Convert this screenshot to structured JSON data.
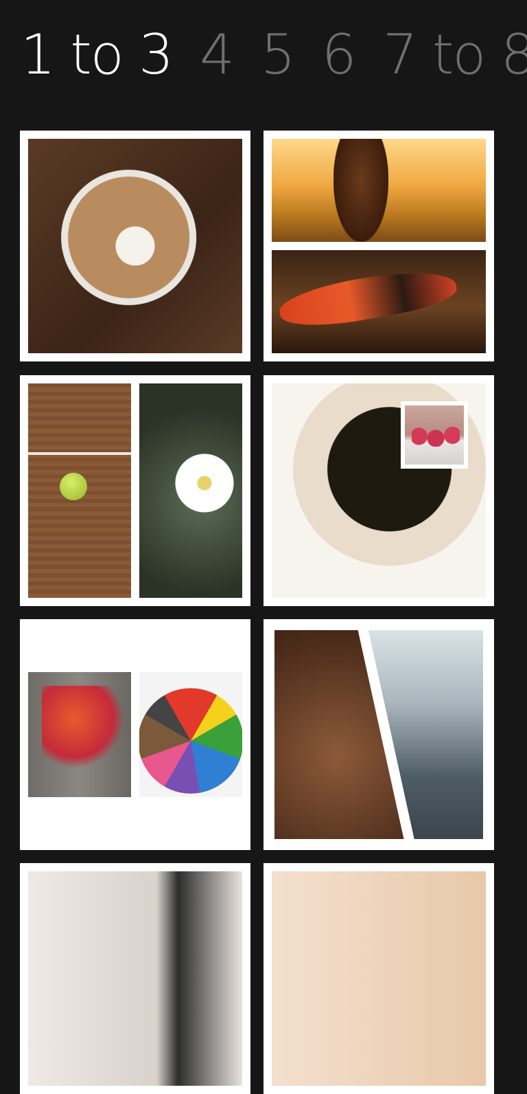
{
  "pivot": {
    "items": [
      {
        "label": "1 to 3",
        "active": true
      },
      {
        "label": "4"
      },
      {
        "label": "5"
      },
      {
        "label": "6"
      },
      {
        "label": "7 to 8"
      }
    ]
  },
  "colors": {
    "background": "#161616",
    "tile_frame": "#ffffff",
    "pivot_active": "#ffffff",
    "pivot_inactive": "#6f6f6f"
  },
  "templates": [
    {
      "name": "single-photo",
      "photos": [
        "latte art coffee cup"
      ]
    },
    {
      "name": "two-horizontal",
      "photos": [
        "girl in sunset field",
        "red lizard"
      ]
    },
    {
      "name": "two-vertical",
      "photos": [
        "tennis ball on clay court",
        "white flowers"
      ]
    },
    {
      "name": "photo-with-inset",
      "photos": [
        "honey dipper in jar",
        "raspberries"
      ]
    },
    {
      "name": "two-centered",
      "photos": [
        "autumn leaves",
        "colored pencils"
      ]
    },
    {
      "name": "diagonal-split",
      "photos": [
        "coffee beans with scoop",
        "rainy window city lights"
      ]
    },
    {
      "name": "partial-tile-left",
      "photos": []
    },
    {
      "name": "partial-tile-right",
      "photos": []
    }
  ]
}
